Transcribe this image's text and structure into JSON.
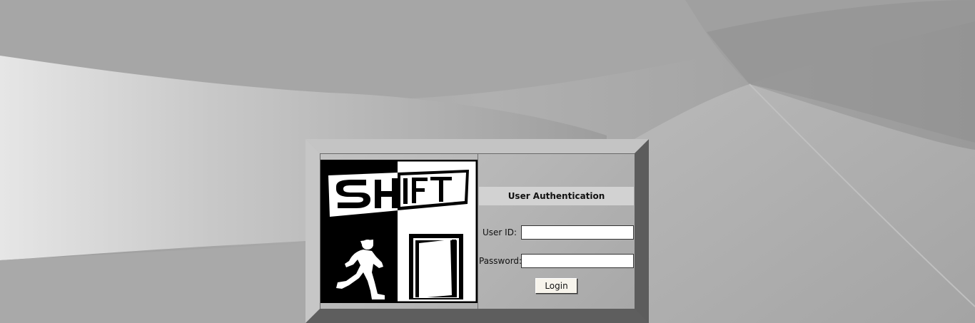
{
  "auth": {
    "title": "User Authentication",
    "user_id_label": "User ID:",
    "user_id_value": "",
    "password_label": "Password:",
    "password_value": "",
    "login_label": "Login"
  },
  "logo": {
    "text": "SHIFT"
  },
  "colors": {
    "background": "#a9a9a9",
    "frame_light": "#b8b8b8",
    "frame_dark": "#5a5a5a",
    "header_band": "#d2d2d2",
    "button_face": "#f7f4ec"
  }
}
